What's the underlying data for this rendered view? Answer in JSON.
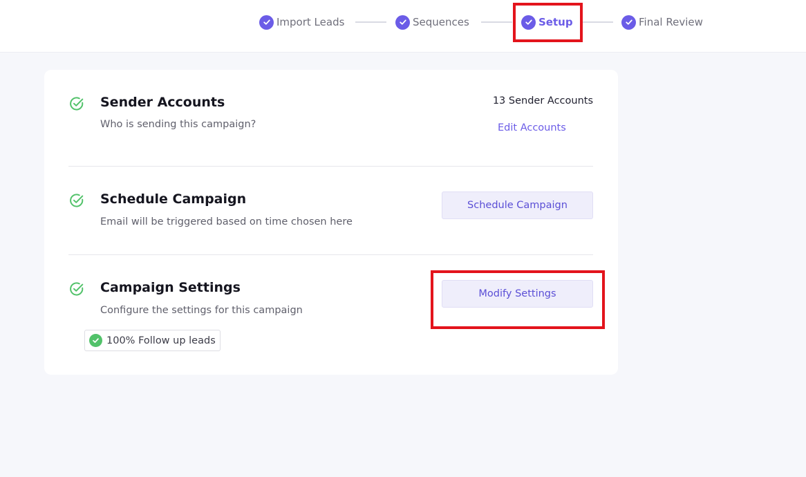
{
  "stepper": {
    "steps": [
      {
        "label": "Import Leads",
        "state": "completed"
      },
      {
        "label": "Sequences",
        "state": "completed"
      },
      {
        "label": "Setup",
        "state": "active"
      },
      {
        "label": "Final Review",
        "state": "completed"
      }
    ],
    "check_icon": "check-circle-icon"
  },
  "colors": {
    "accent": "#6b5ce7",
    "success": "#52c26a",
    "highlight": "#e3141c",
    "button_bg": "#efeefb"
  },
  "sections": {
    "sender": {
      "title": "Sender Accounts",
      "description": "Who is sending this campaign?",
      "count_text": "13 Sender Accounts",
      "action_label": "Edit Accounts"
    },
    "schedule": {
      "title": "Schedule Campaign",
      "description": "Email will be triggered based on time chosen here",
      "action_label": "Schedule Campaign"
    },
    "settings": {
      "title": "Campaign Settings",
      "description": "Configure the settings for this campaign",
      "action_label": "Modify Settings",
      "tag_label": "100% Follow up leads"
    }
  }
}
